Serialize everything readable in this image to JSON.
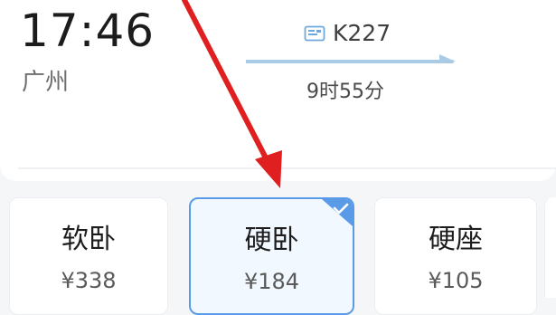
{
  "departure": {
    "time": "17:46",
    "station": "广州"
  },
  "train": {
    "icon": "ticket-icon",
    "number": "K227",
    "duration": "9时55分"
  },
  "seats": [
    {
      "name": "软卧",
      "price": "¥338",
      "selected": false
    },
    {
      "name": "硬卧",
      "price": "¥184",
      "selected": true
    },
    {
      "name": "硬座",
      "price": "¥105",
      "selected": false
    }
  ],
  "colors": {
    "accent": "#5a9be8",
    "route_line": "#a9cbe6",
    "annotation_arrow": "#e02020"
  }
}
